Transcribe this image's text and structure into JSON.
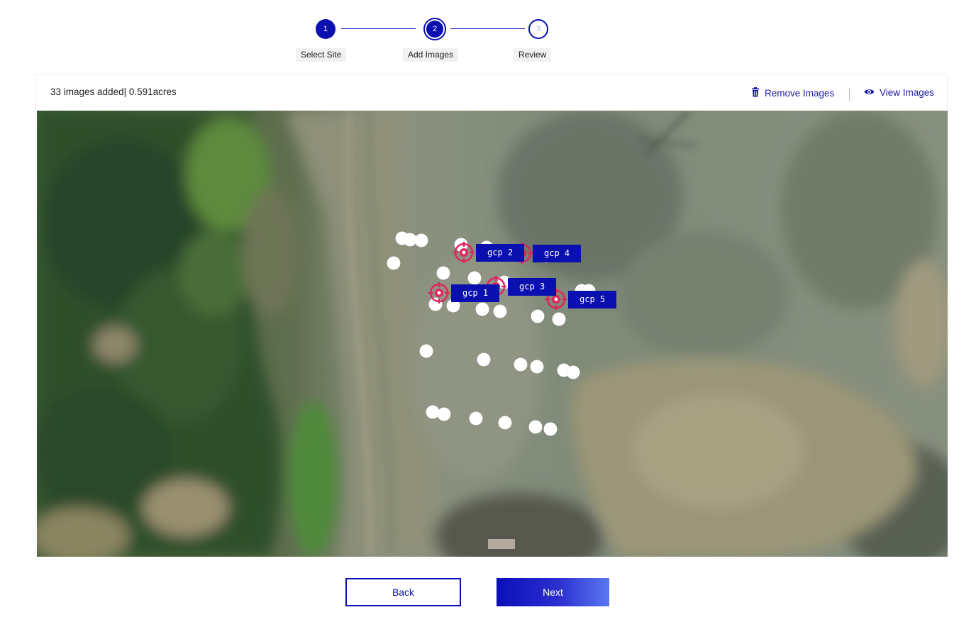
{
  "stepper": {
    "steps": [
      {
        "number": "1",
        "label": "Select Site",
        "state": "done"
      },
      {
        "number": "2",
        "label": "Add Images",
        "state": "active"
      },
      {
        "number": "3",
        "label": "Review",
        "state": "todo"
      }
    ]
  },
  "header": {
    "summary": "33 images added| 0.591acres",
    "remove_label": "Remove Images",
    "view_label": "View Images"
  },
  "map": {
    "gcps": [
      {
        "label": "gcp 1"
      },
      {
        "label": "gcp 2"
      },
      {
        "label": "gcp 3"
      },
      {
        "label": "gcp 4"
      },
      {
        "label": "gcp 5"
      }
    ]
  },
  "actions": {
    "back_label": "Back",
    "next_label": "Next"
  },
  "colors": {
    "primary": "#0a0fb0",
    "gcp_marker": "#e0245e"
  }
}
